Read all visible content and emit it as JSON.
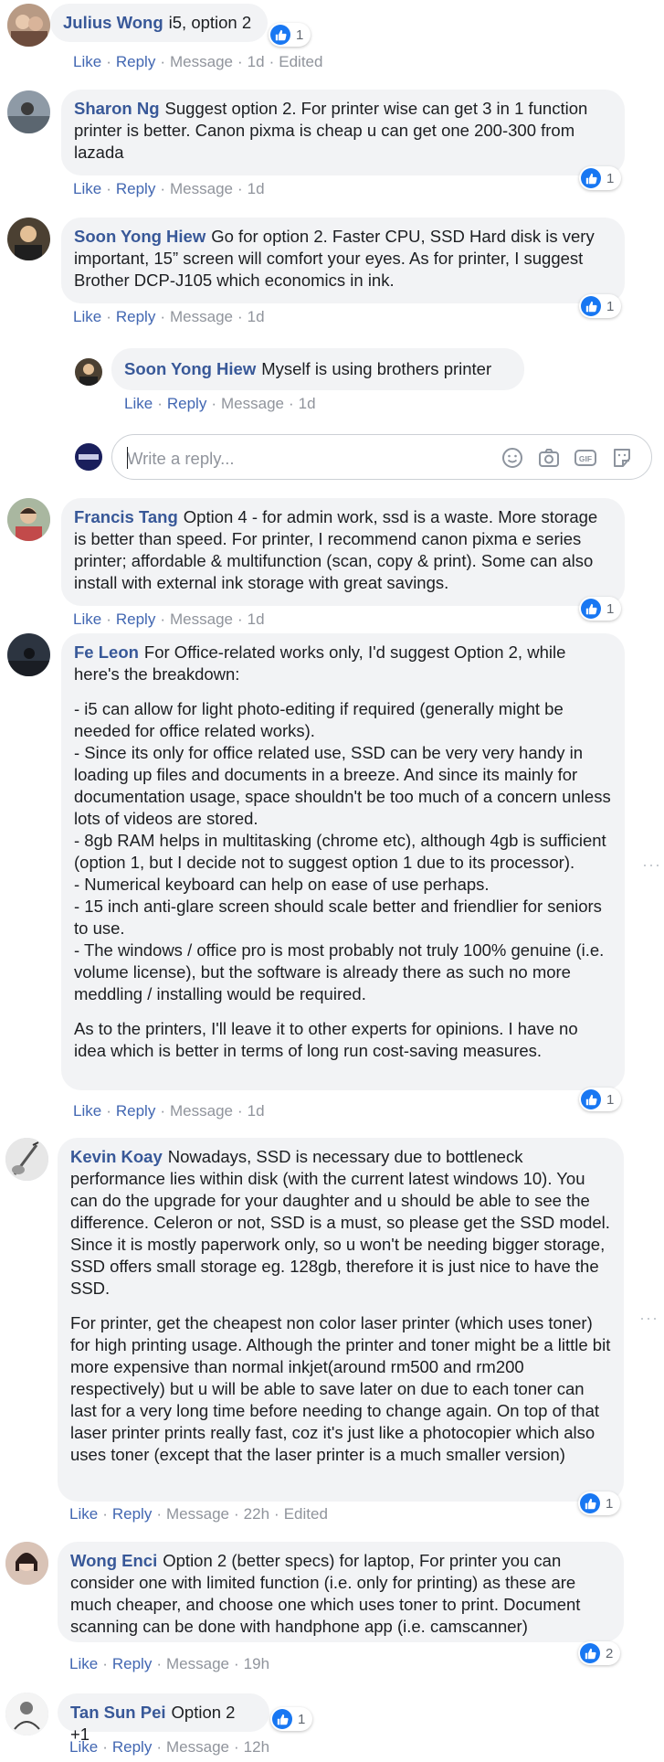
{
  "actions": {
    "like": "Like",
    "reply": "Reply",
    "message": "Message",
    "edited": "Edited"
  },
  "reply_box": {
    "placeholder": "Write a reply..."
  },
  "comments": [
    {
      "name": "Julius Wong",
      "text": [
        "i5, option 2"
      ],
      "time": "1d",
      "edited": true,
      "likes": "1"
    },
    {
      "name": "Sharon Ng",
      "text": [
        "Suggest option 2. For printer wise can get 3 in 1 function printer is better. Canon pixma is cheap u can get one 200-300 from lazada"
      ],
      "time": "1d",
      "likes": "1"
    },
    {
      "name": "Soon Yong Hiew",
      "text": [
        "Go for option 2. Faster CPU, SSD Hard disk is very important, 15” screen will comfort your eyes. As for printer, I suggest Brother DCP-J105 which economics in ink."
      ],
      "time": "1d",
      "likes": "1"
    },
    {
      "name": "Soon Yong Hiew",
      "text": [
        "Myself is using brothers printer"
      ],
      "time": "1d"
    },
    {
      "name": "Francis Tang",
      "text": [
        "Option 4 - for admin work, ssd is a waste. More storage is better than speed. For printer, I recommend canon pixma e series printer; affordable & multifunction (scan, copy & print). Some can also install with external ink storage with great savings."
      ],
      "time": "1d",
      "likes": "1"
    },
    {
      "name": "Fe Leon",
      "text": [
        "For Office-related works only, I'd suggest Option 2, while here's the breakdown:",
        "- i5 can allow for light photo-editing if required (generally might be needed for office related works).",
        "- Since its only for office related use, SSD can be very very handy in loading up files and documents in a breeze. And since its mainly for documentation usage, space shouldn't be too much of a concern unless lots of videos are stored.",
        "- 8gb RAM helps in multitasking (chrome etc), although 4gb is sufficient (option 1, but I decide not to suggest option 1 due to its processor).",
        "- Numerical keyboard can help on ease of use perhaps.",
        "- 15 inch anti-glare screen should scale better and friendlier for seniors to use.",
        "- The windows / office pro is most probably not truly 100% genuine (i.e. volume license), but the software is already there as such no more meddling / installing would be required.",
        "As to the printers, I'll leave it to other experts for opinions. I have no idea which is better in terms of long run cost-saving measures."
      ],
      "time": "1d",
      "likes": "1"
    },
    {
      "name": "Kevin Koay",
      "text": [
        "Nowadays, SSD is necessary due to bottleneck performance lies within disk (with the current latest windows 10). You can do the upgrade for your daughter and u should be able to see the difference. Celeron or not, SSD is a must, so please get the SSD model. Since it is mostly paperwork only, so u won't be needing bigger storage, SSD offers small storage eg. 128gb, therefore it is just nice to have the SSD.",
        "For printer, get the cheapest non color laser printer (which uses toner) for high printing usage. Although the printer and toner might be a little bit more expensive than normal inkjet(around rm500 and rm200 respectively) but u will be able to save later on due to each toner can last for a very long time before needing to change again. On top of that laser printer prints really fast, coz it's just like a photocopier which also uses toner (except that the laser printer is a much smaller version)"
      ],
      "time": "22h",
      "edited": true,
      "likes": "1"
    },
    {
      "name": "Wong Enci",
      "text": [
        "Option 2 (better specs) for laptop, For printer you can consider one with limited function (i.e. only for printing) as these are much cheaper, and choose one which uses toner to print. Document scanning can be done with handphone app (i.e. camscanner)"
      ],
      "time": "19h",
      "likes": "2"
    },
    {
      "name": "Tan Sun Pei",
      "text": [
        "Option 2 +1"
      ],
      "time": "12h",
      "likes": "1"
    }
  ]
}
